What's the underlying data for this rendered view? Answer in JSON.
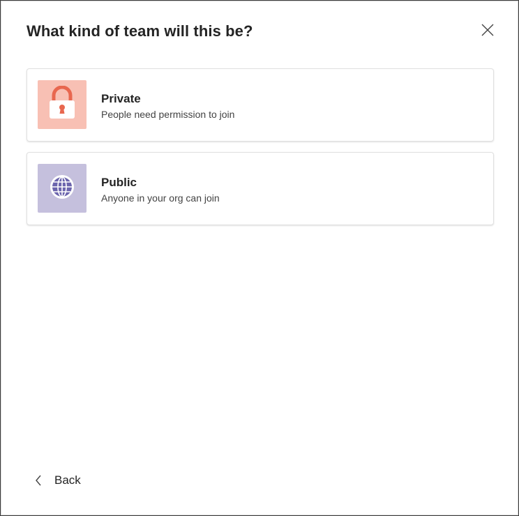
{
  "dialog": {
    "title": "What kind of team will this be?",
    "close_icon": "close-icon"
  },
  "options": [
    {
      "title": "Private",
      "description": "People need permission to join",
      "icon": "lock-icon",
      "tile_color": "#f8c0b4",
      "icon_color": "#e8674f"
    },
    {
      "title": "Public",
      "description": "Anyone in your org can join",
      "icon": "globe-icon",
      "tile_color": "#c5c0dd",
      "icon_color": "#6b64ad"
    }
  ],
  "footer": {
    "back_label": "Back",
    "back_icon": "chevron-left-icon"
  }
}
